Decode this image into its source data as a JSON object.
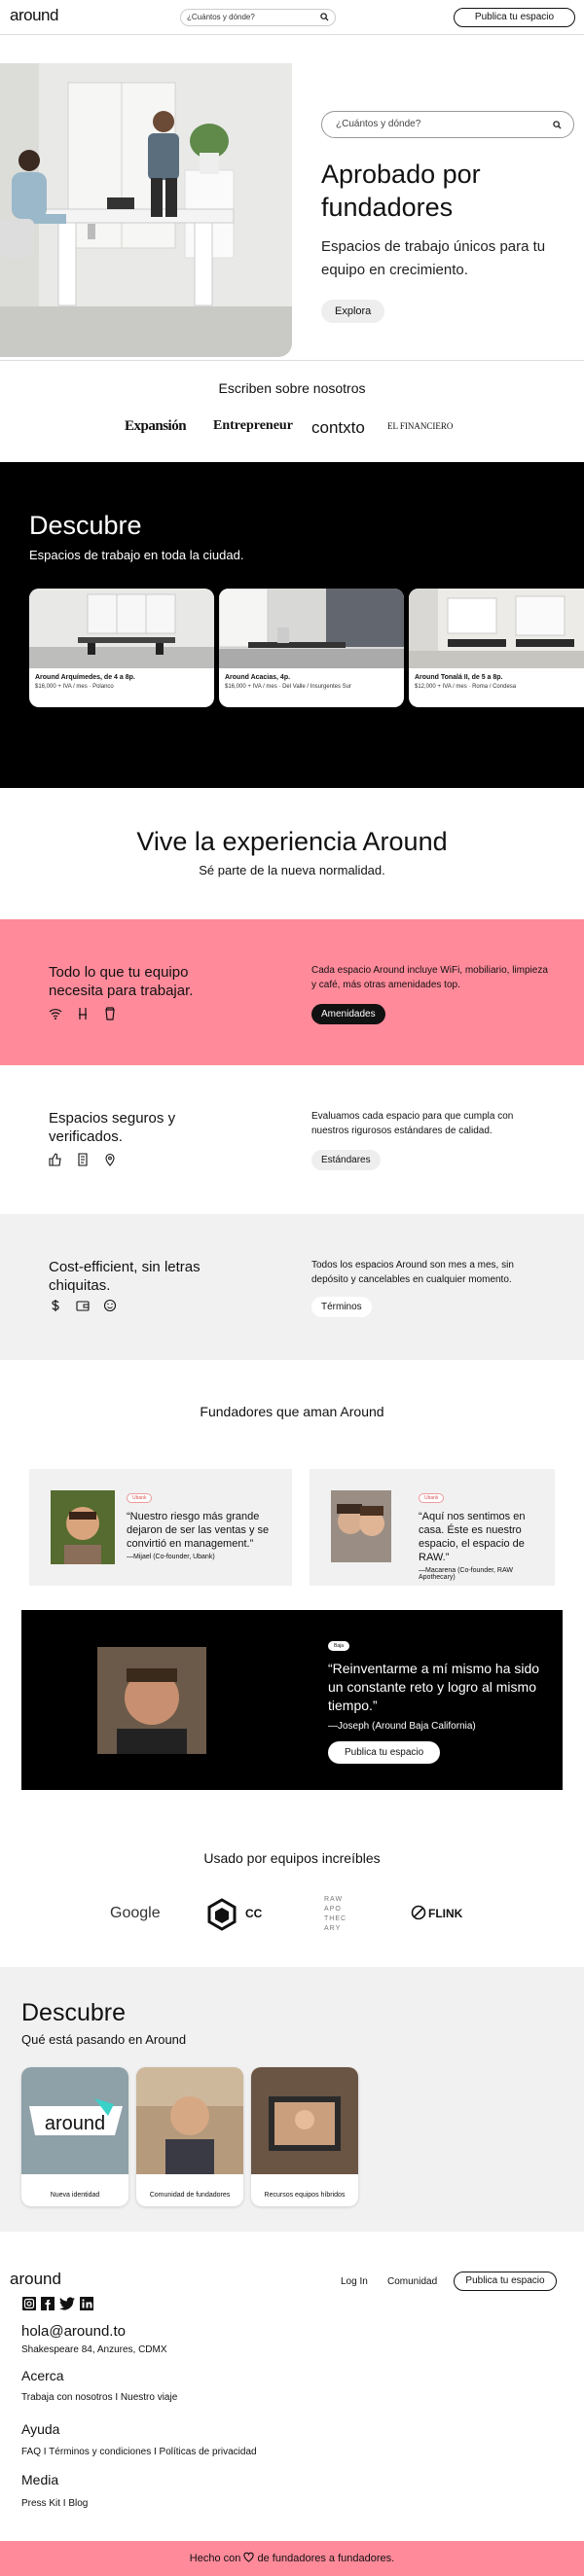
{
  "header": {
    "logo": "around",
    "search_placeholder": "¿Cuántos y dónde?",
    "cta": "Publica tu espacio"
  },
  "hero": {
    "search_placeholder": "¿Cuántos y dónde?",
    "title": "Aprobado por fundadores",
    "subtitle": "Espacios de trabajo únicos para tu equipo en crecimiento.",
    "button": "Explora"
  },
  "press": {
    "title": "Escriben sobre nosotros",
    "logos": [
      "Expansión",
      "Entrepreneur",
      "contxto",
      "EL FINANCIERO"
    ]
  },
  "discover": {
    "title": "Descubre",
    "subtitle": "Espacios de trabajo en toda la ciudad.",
    "cards": [
      {
        "title": "Around Arquímedes, de 4 a 8p.",
        "sub": "$16,000 + IVA / mes · Polanco"
      },
      {
        "title": "Around Acacias, 4p.",
        "sub": "$16,000 + IVA / mes · Del Valle / Insurgentes Sur"
      },
      {
        "title": "Around Tonalá II, de 5 a 8p.",
        "sub": "$12,000 + IVA / mes · Roma / Condesa"
      }
    ]
  },
  "experience": {
    "title": "Vive la experiencia Around",
    "subtitle": "Sé parte de la nueva normalidad."
  },
  "features": [
    {
      "title": "Todo lo que tu equipo necesita para trabajar.",
      "text": "Cada espacio Around incluye WiFi, mobiliario, limpieza y café, más otras amenidades top.",
      "button": "Amenidades",
      "bg": "#ff8a9a"
    },
    {
      "title": "Espacios seguros y verificados.",
      "text": "Evaluamos cada espacio para que cumpla con nuestros rigurosos estándares de calidad.",
      "button": "Estándares",
      "bg": "#ffffff"
    },
    {
      "title": "Cost-efficient, sin letras chiquitas.",
      "text": "Todos los espacios Around son mes a mes, sin depósito y cancelables en cualquier momento.",
      "button": "Términos",
      "bg": "#f1f1f1"
    }
  ],
  "founders": {
    "title": "Fundadores que aman Around",
    "testimonials": [
      {
        "tag": "Ubank",
        "quote": "“Nuestro riesgo más grande dejaron de ser las ventas y se convirtió en management.”",
        "who": "—Mijael (Co-founder, Ubank)"
      },
      {
        "tag": "Ubank",
        "quote": "“Aquí nos sentimos en casa. Éste es nuestro espacio, el espacio de RAW.”",
        "who": "—Macarena (Co-founder, RAW Apothecary)"
      }
    ],
    "feature": {
      "tag": "Baja",
      "quote": "“Reinventarme a mí mismo ha sido un constante reto y logro al mismo tiempo.”",
      "who": "—Joseph (Around Baja California)",
      "button": "Publica tu espacio"
    }
  },
  "teams": {
    "title": "Usado por equipos increíbles",
    "logos": [
      "Google",
      "CC",
      "RAW APO THEC ARY",
      "FLINK"
    ]
  },
  "blog": {
    "title": "Descubre",
    "subtitle": "Qué está pasando en Around",
    "cards": [
      "Nueva identidad",
      "Comunidad de fundadores",
      "Recursos equipos híbridos"
    ],
    "card_logo": "around"
  },
  "footer": {
    "logo": "around",
    "nav": [
      "Log In",
      "Comunidad",
      "Publica tu espacio"
    ],
    "email": "hola@around.to",
    "address": "Shakespeare 84, Anzures, CDMX",
    "sections": [
      {
        "title": "Acerca",
        "links": "Trabaja con nosotros I Nuestro viaje"
      },
      {
        "title": "Ayuda",
        "links": "FAQ I Términos y condiciones I Políticas de privacidad"
      },
      {
        "title": "Media",
        "links": "Press Kit I Blog"
      }
    ],
    "bottom_pre": "Hecho con",
    "bottom_post": "de fundadores a fundadores.",
    "bottom_bg": "#ff8a9a"
  },
  "colors": {
    "accent_pink": "#ff8a9a",
    "dark": "#000000"
  }
}
